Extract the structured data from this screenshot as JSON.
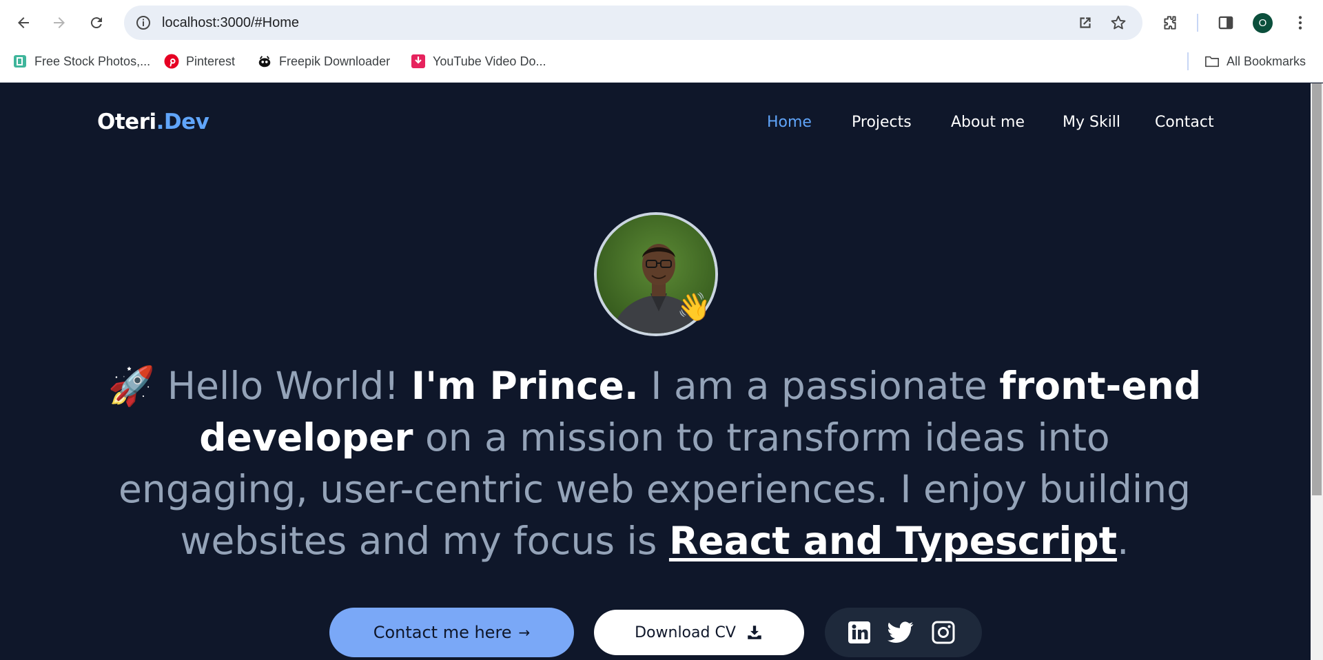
{
  "browser": {
    "url": "localhost:3000/#Home",
    "profile_initial": "O",
    "bookmarks": [
      {
        "label": "Free Stock Photos,..."
      },
      {
        "label": "Pinterest"
      },
      {
        "label": "Freepik Downloader"
      },
      {
        "label": "YouTube Video Do..."
      }
    ],
    "all_bookmarks_label": "All Bookmarks"
  },
  "site": {
    "logo_main": "Oteri",
    "logo_accent": ".Dev",
    "nav": [
      "Home",
      "Projects",
      "About me",
      "My Skill",
      "Contact"
    ],
    "active_nav": "Home",
    "accent_color": "#60a5fa",
    "background_color": "#0f172a"
  },
  "hero": {
    "rocket_emoji": "🚀",
    "wave_emoji": "👋",
    "greeting": " Hello World! ",
    "name": "I'm Prince.",
    "text_1": " I am a passionate ",
    "role": "front-end developer",
    "text_2": " on a mission to transform ideas into engaging, user-centric web experiences. I enjoy building websites and my focus is ",
    "focus": "React and Typescript",
    "end": "."
  },
  "actions": {
    "contact_label": "Contact me here",
    "contact_arrow": "→",
    "cv_label": "Download CV",
    "socials": [
      "linkedin-icon",
      "twitter-icon",
      "instagram-icon"
    ]
  }
}
